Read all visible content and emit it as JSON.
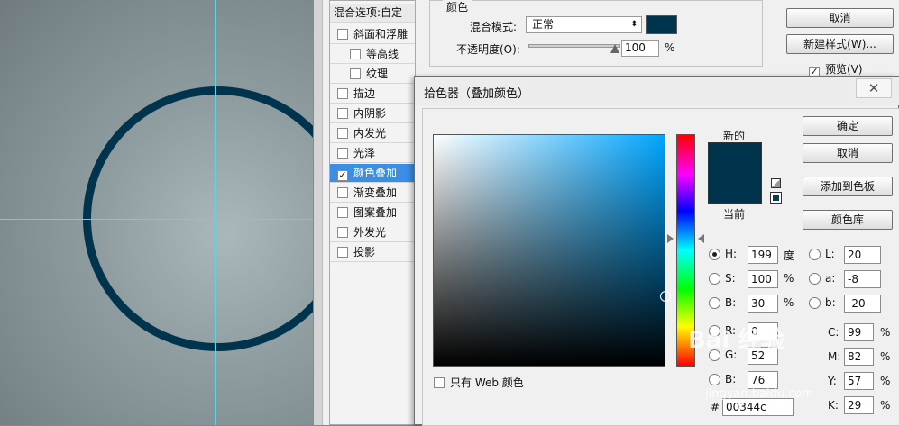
{
  "colors": {
    "overlay": "#00344c",
    "guide": "#38e3f5",
    "selection": "#3a8ee6"
  },
  "layer_style": {
    "list_header": "混合选项:自定",
    "items": [
      {
        "label": "斜面和浮雕",
        "checked": false
      },
      {
        "label": "等高线",
        "checked": false
      },
      {
        "label": "纹理",
        "checked": false
      },
      {
        "label": "描边",
        "checked": false
      },
      {
        "label": "内阴影",
        "checked": false
      },
      {
        "label": "内发光",
        "checked": false
      },
      {
        "label": "光泽",
        "checked": false
      },
      {
        "label": "颜色叠加",
        "checked": true
      },
      {
        "label": "渐变叠加",
        "checked": false
      },
      {
        "label": "图案叠加",
        "checked": false
      },
      {
        "label": "外发光",
        "checked": false
      },
      {
        "label": "投影",
        "checked": false
      }
    ],
    "color_group": {
      "legend": "颜色",
      "blend_mode_label": "混合模式:",
      "blend_mode_value": "正常",
      "opacity_label": "不透明度(O):",
      "opacity_value": "100",
      "opacity_unit": "%"
    },
    "buttons": {
      "cancel": "取消",
      "new_style": "新建样式(W)...",
      "preview": "预览(V)"
    }
  },
  "picker": {
    "title": "拾色器（叠加颜色）",
    "label_new": "新的",
    "label_current": "当前",
    "buttons": {
      "ok": "确定",
      "cancel": "取消",
      "add_swatch": "添加到色板",
      "libraries": "颜色库"
    },
    "hsb": {
      "h": {
        "label": "H:",
        "value": "199",
        "unit": "度"
      },
      "s": {
        "label": "S:",
        "value": "100",
        "unit": "%"
      },
      "b": {
        "label": "B:",
        "value": "30",
        "unit": "%"
      }
    },
    "rgb": {
      "r": {
        "label": "R:",
        "value": "0"
      },
      "g": {
        "label": "G:",
        "value": "52"
      },
      "b": {
        "label": "B:",
        "value": "76"
      }
    },
    "lab": {
      "l": {
        "label": "L:",
        "value": "20"
      },
      "a": {
        "label": "a:",
        "value": "-8"
      },
      "b": {
        "label": "b:",
        "value": "-20"
      }
    },
    "cmyk": {
      "c": {
        "label": "C:",
        "value": "99",
        "unit": "%"
      },
      "m": {
        "label": "M:",
        "value": "82",
        "unit": "%"
      },
      "y": {
        "label": "Y:",
        "value": "57",
        "unit": "%"
      },
      "k": {
        "label": "K:",
        "value": "29",
        "unit": "%"
      }
    },
    "hex_label": "#",
    "hex_value": "00344c",
    "web_only": "只有 Web 颜色"
  },
  "watermark": {
    "text": "Bai 经验",
    "url": "jingyan.baidu.com"
  }
}
